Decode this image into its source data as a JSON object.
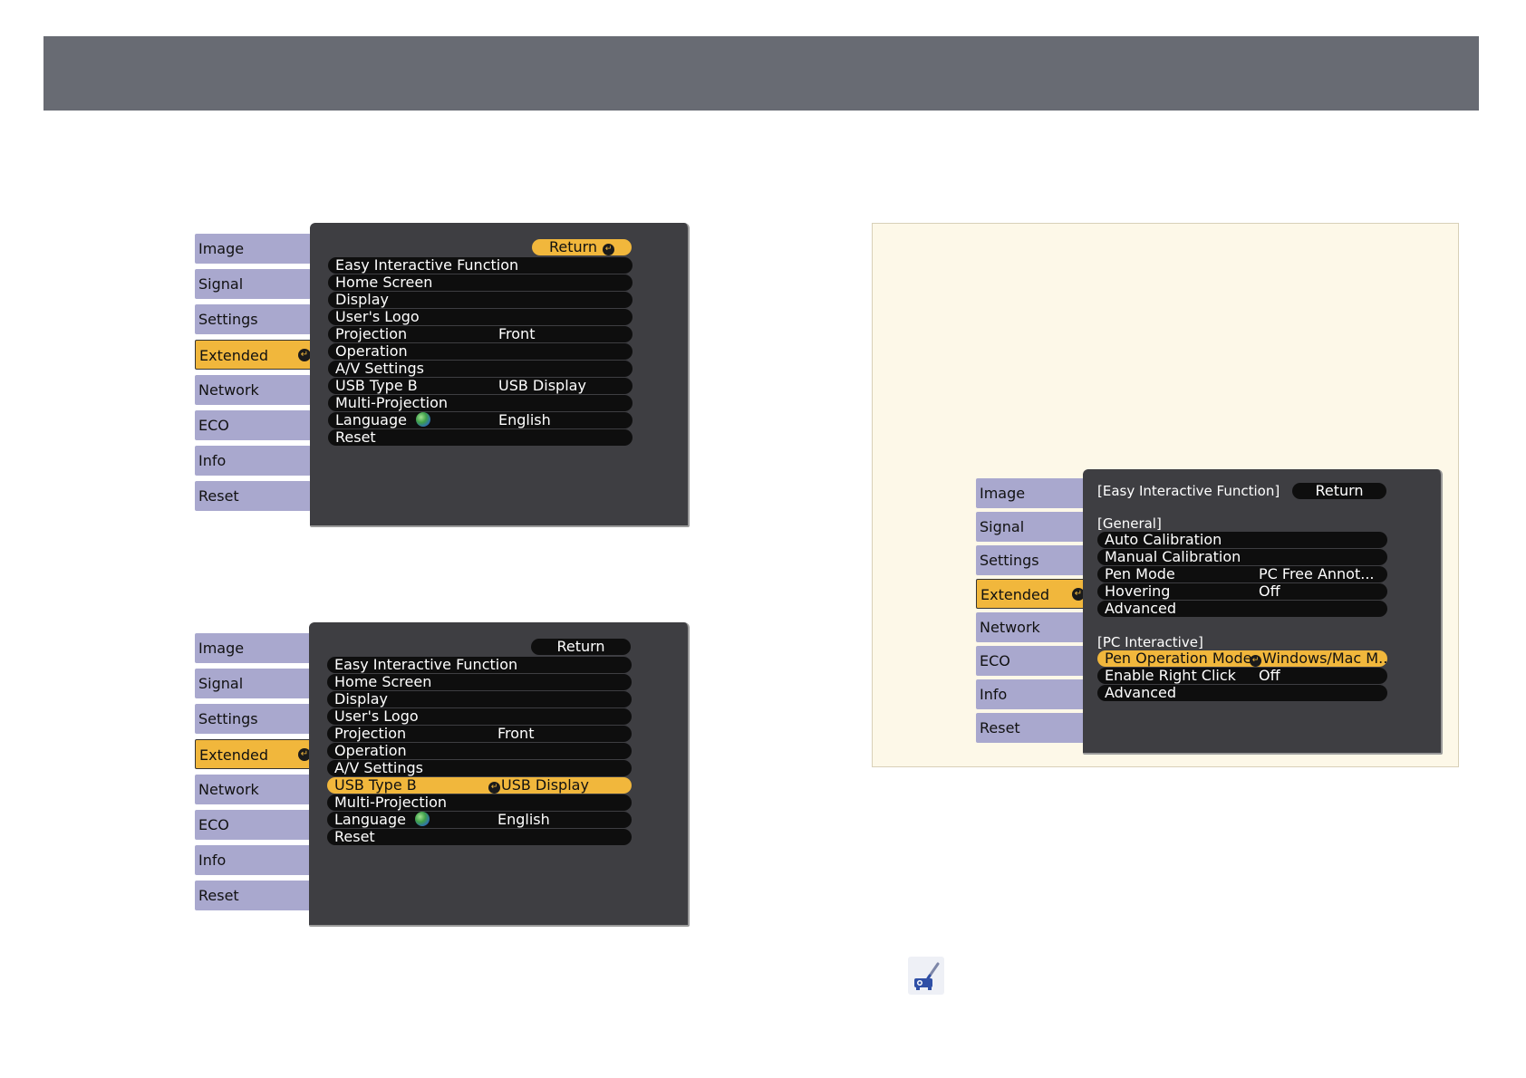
{
  "menu_top": {
    "sidebar": [
      "Image",
      "Signal",
      "Settings",
      "Extended",
      "Network",
      "ECO",
      "Info",
      "Reset"
    ],
    "active_index": 3,
    "return_label": "Return",
    "rows": [
      {
        "label": "Easy Interactive Function",
        "value": ""
      },
      {
        "label": "Home Screen",
        "value": ""
      },
      {
        "label": "Display",
        "value": ""
      },
      {
        "label": "User's Logo",
        "value": ""
      },
      {
        "label": "Projection",
        "value": "Front"
      },
      {
        "label": "Operation",
        "value": ""
      },
      {
        "label": "A/V Settings",
        "value": ""
      },
      {
        "label": "USB Type B",
        "value": "USB Display"
      },
      {
        "label": "Multi-Projection",
        "value": ""
      },
      {
        "label": "Language",
        "value": "English"
      },
      {
        "label": "Reset",
        "value": ""
      }
    ]
  },
  "menu_bottom": {
    "sidebar": [
      "Image",
      "Signal",
      "Settings",
      "Extended",
      "Network",
      "ECO",
      "Info",
      "Reset"
    ],
    "active_index": 3,
    "return_label": "Return",
    "selected_row": 7,
    "rows": [
      {
        "label": "Easy Interactive Function",
        "value": ""
      },
      {
        "label": "Home Screen",
        "value": ""
      },
      {
        "label": "Display",
        "value": ""
      },
      {
        "label": "User's Logo",
        "value": ""
      },
      {
        "label": "Projection",
        "value": "Front"
      },
      {
        "label": "Operation",
        "value": ""
      },
      {
        "label": "A/V Settings",
        "value": ""
      },
      {
        "label": "USB Type B",
        "value": "USB Display"
      },
      {
        "label": "Multi-Projection",
        "value": ""
      },
      {
        "label": "Language",
        "value": "English"
      },
      {
        "label": "Reset",
        "value": ""
      }
    ]
  },
  "menu_easy": {
    "sidebar": [
      "Image",
      "Signal",
      "Settings",
      "Extended",
      "Network",
      "ECO",
      "Info",
      "Reset"
    ],
    "active_index": 3,
    "heading": "[Easy Interactive Function]",
    "return_label": "Return",
    "general_label": "[General]",
    "general_rows": [
      {
        "label": "Auto Calibration",
        "value": ""
      },
      {
        "label": "Manual Calibration",
        "value": ""
      },
      {
        "label": "Pen Mode",
        "value": "PC Free Annot..."
      },
      {
        "label": "Hovering",
        "value": "Off"
      },
      {
        "label": "Advanced",
        "value": ""
      }
    ],
    "pc_label": "[PC Interactive]",
    "pc_rows": [
      {
        "label": "Pen Operation Mode",
        "value": "Windows/Mac M..."
      },
      {
        "label": "Enable Right Click",
        "value": "Off"
      },
      {
        "label": "Advanced",
        "value": ""
      }
    ]
  },
  "colors": {
    "top_bar": "#686b73",
    "sidebar_item": "#a9a8ce",
    "highlight": "#f1b73c",
    "panel": "#3e3e42",
    "note_bg": "#fdf8e8"
  },
  "icons": {
    "note": "projector-pen-icon"
  }
}
